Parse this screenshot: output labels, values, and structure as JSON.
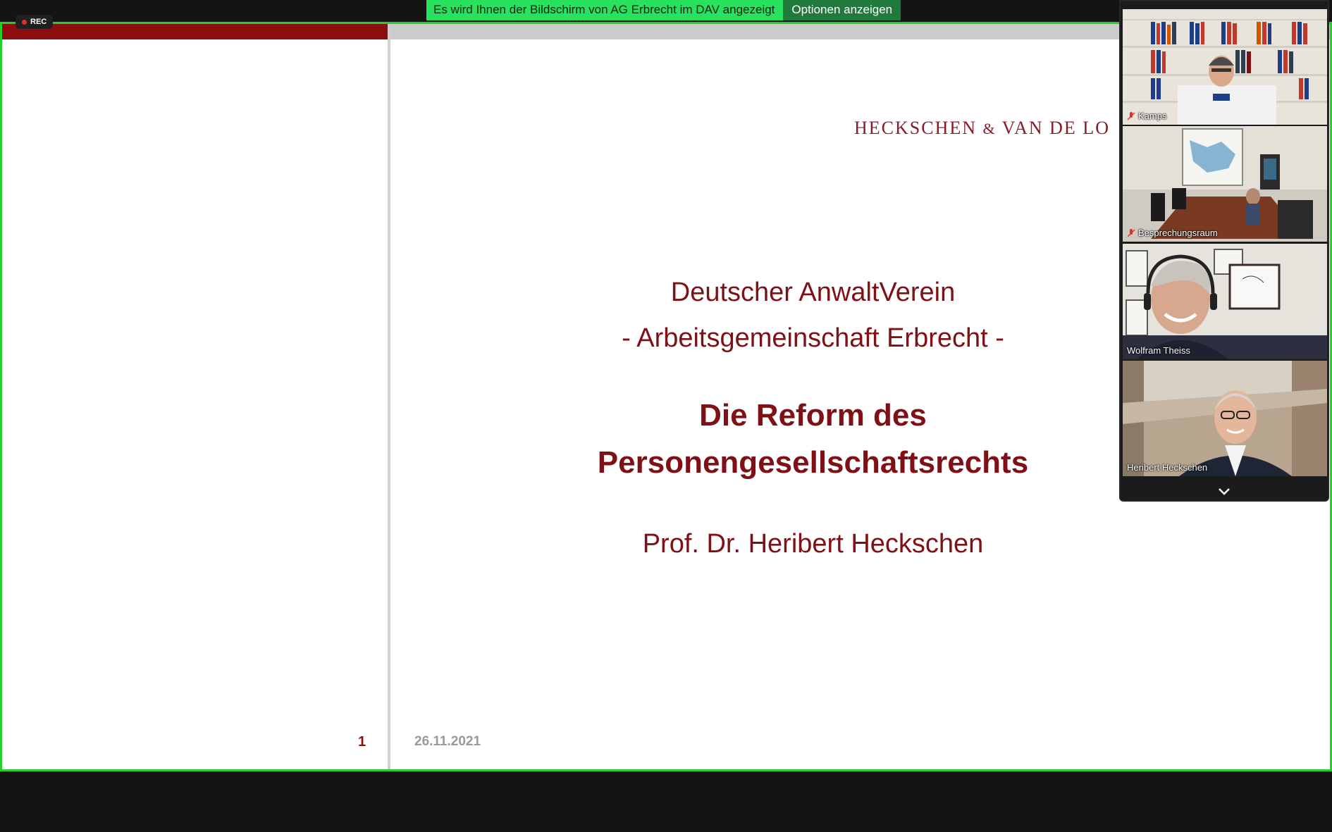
{
  "banner": {
    "share_message": "Es wird Ihnen der Bildschirm von AG Erbrecht im DAV angezeigt",
    "options_label": "Optionen anzeigen"
  },
  "recording": {
    "label": "REC"
  },
  "slide": {
    "firm_name": "HECKSCHEN",
    "firm_amp": "&",
    "firm_name_2": "VAN DE LO",
    "org": "Deutscher AnwaltVerein",
    "working_group": "- Arbeitsgemeinschaft Erbrecht -",
    "title_line1": "Die Reform des",
    "title_line2": "Personengesellschaftsrechts",
    "author": "Prof. Dr. Heribert Heckschen",
    "page_number": "1",
    "date": "26.11.2021"
  },
  "participants": [
    {
      "name": "Kamps",
      "muted": true
    },
    {
      "name": "Besprechungsraum",
      "muted": true
    },
    {
      "name": "Wolfram Theiss",
      "muted": false
    },
    {
      "name": "Heribert Heckschen",
      "muted": false
    }
  ],
  "colors": {
    "share_border": "#23d02a",
    "banner_green": "#28e15c",
    "slide_red": "#7f1116",
    "date_grey": "#9a9a9a"
  }
}
